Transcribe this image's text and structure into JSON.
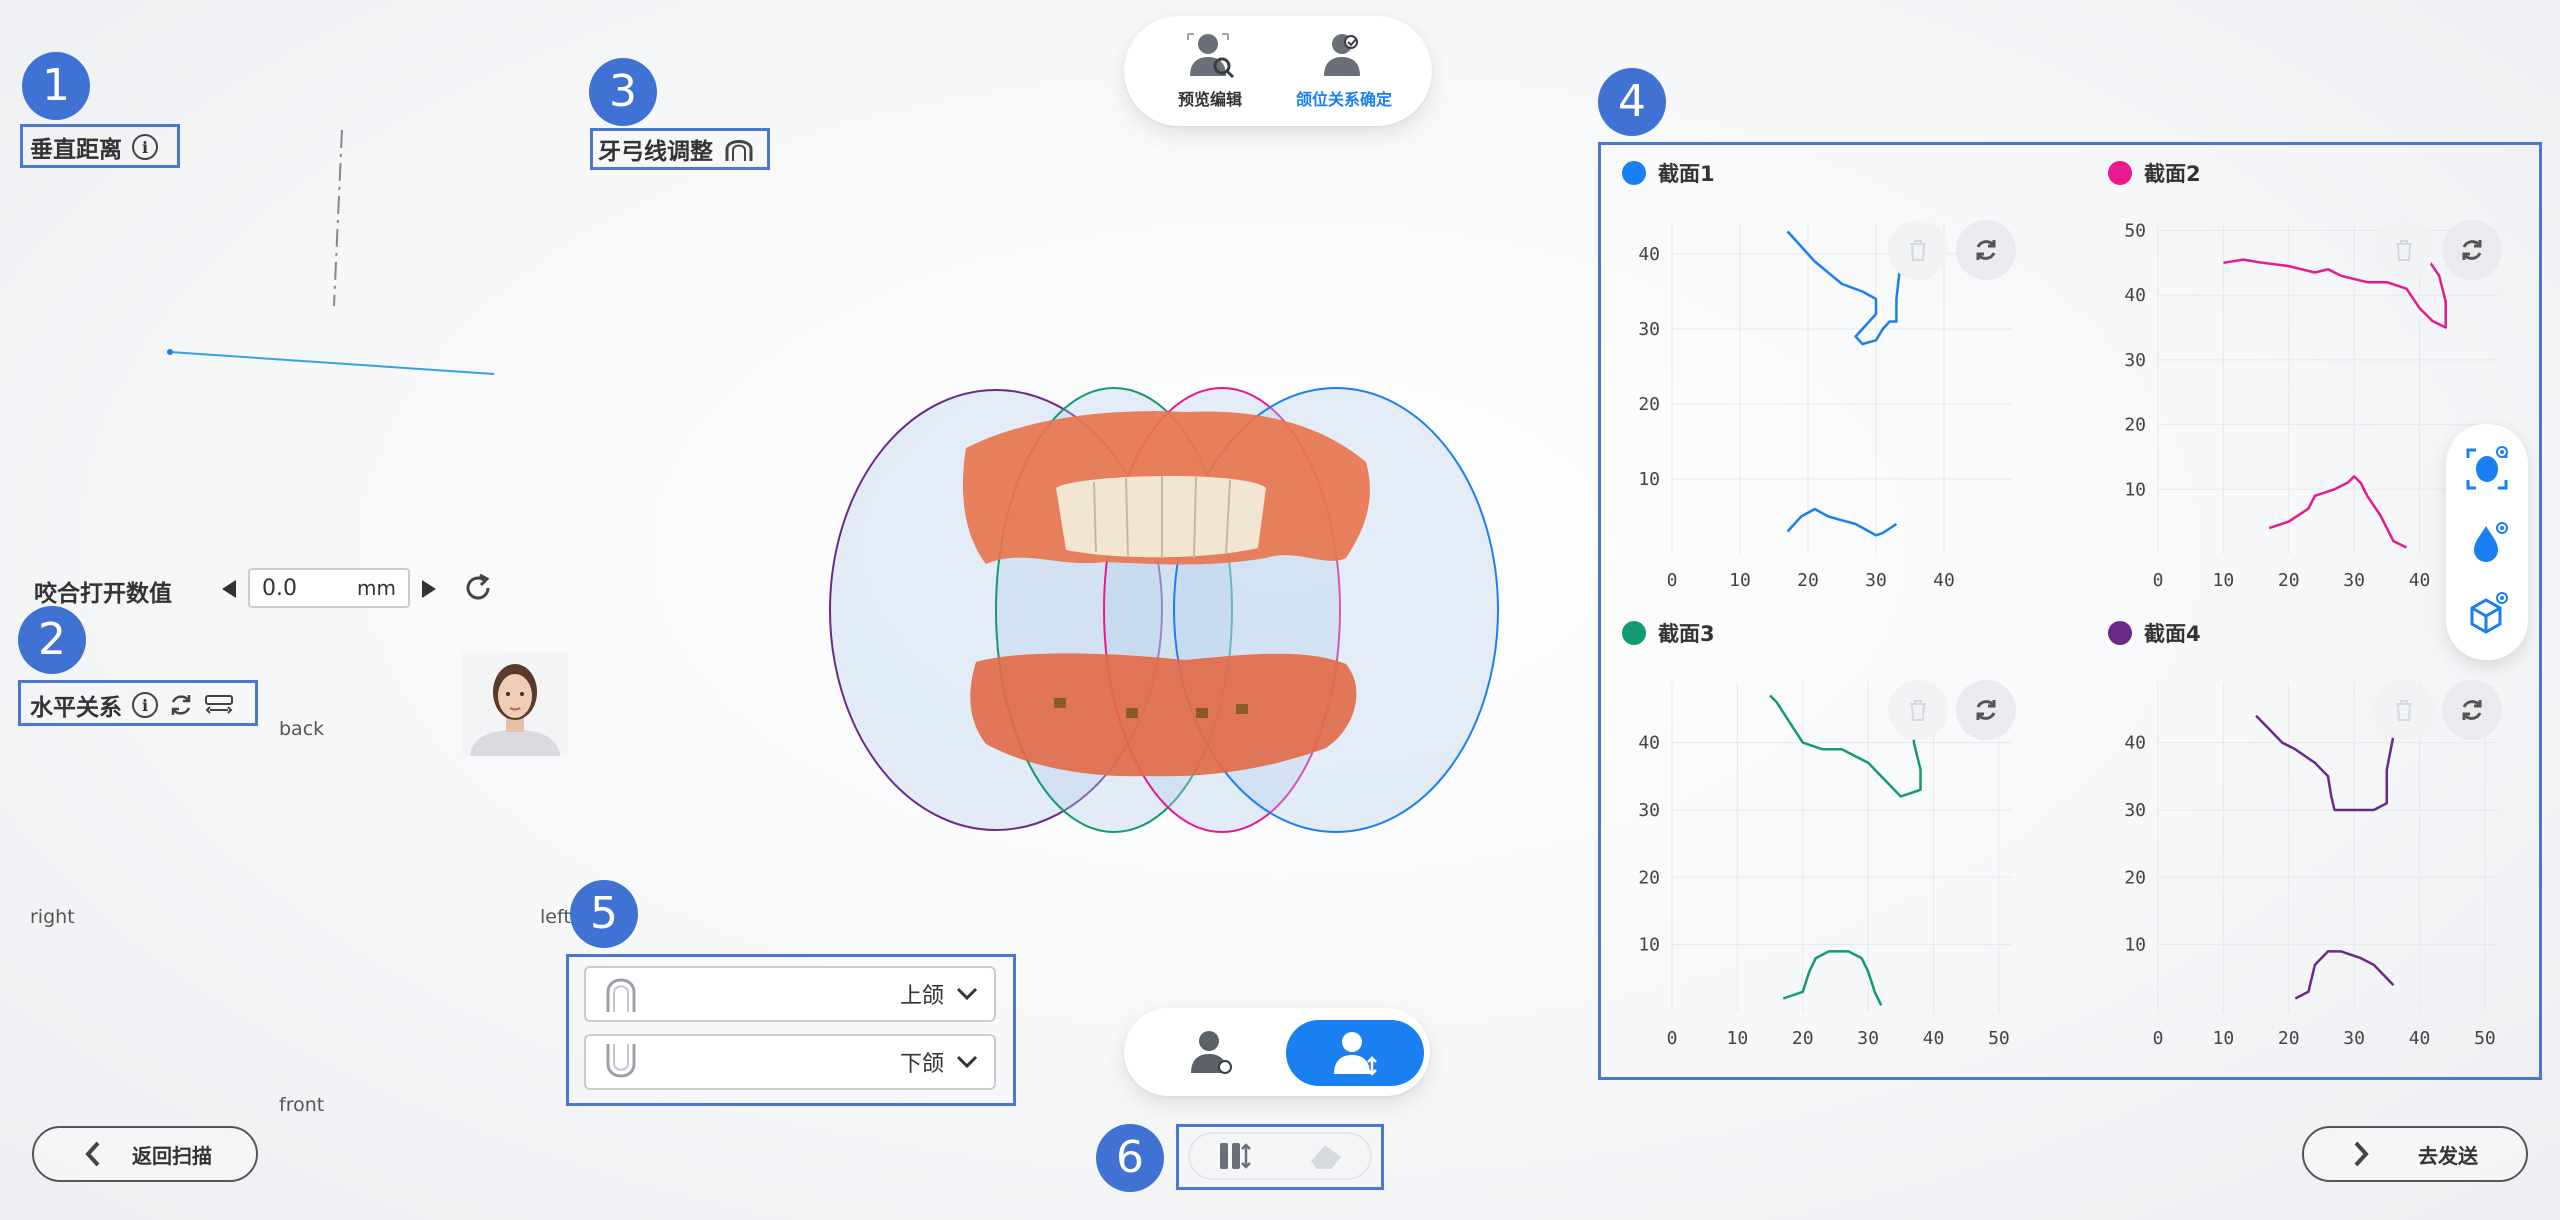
{
  "top_toolbar": {
    "preview_edit": "预览编辑",
    "jaw_relation_confirm": "颌位关系确定",
    "accent": "#1a7ff0"
  },
  "markers": [
    "1",
    "2",
    "3",
    "4",
    "5",
    "6"
  ],
  "left_panel": {
    "vertical_distance": "垂直距离",
    "arch_line_adjust": "牙弓线调整",
    "bite_open_label": "咬合打开数值",
    "bite_open_value": "0.0",
    "bite_open_unit": "mm",
    "horizontal_relation": "水平关系",
    "orientation": {
      "back": "back",
      "right": "right",
      "left": "left",
      "front": "front"
    }
  },
  "jaw_select": [
    {
      "icon": "upper-arch-icon",
      "value": "上颌"
    },
    {
      "icon": "lower-arch-icon",
      "value": "下颌"
    }
  ],
  "buttons": {
    "back_scan": "返回扫描",
    "send": "去发送"
  },
  "sections": {
    "colors": {
      "s1": "#1a7ff0",
      "s2": "#e8198e",
      "s3": "#139a72",
      "s4": "#6a2a86"
    },
    "titles": [
      "截面1",
      "截面2",
      "截面3",
      "截面4"
    ]
  },
  "chart_data": [
    {
      "type": "line",
      "title": "截面1",
      "xlim": [
        0,
        50
      ],
      "ylim": [
        0,
        44
      ],
      "xticks": [
        0,
        10,
        20,
        30,
        40
      ],
      "yticks": [
        10,
        20,
        30,
        40
      ],
      "series": [
        {
          "points": [
            [
              17,
              43
            ],
            [
              21,
              39
            ],
            [
              25,
              36
            ],
            [
              28,
              35
            ],
            [
              30,
              34
            ],
            [
              30,
              32
            ],
            [
              28,
              30
            ],
            [
              27,
              29
            ],
            [
              28,
              28
            ],
            [
              30,
              28.5
            ],
            [
              31,
              30
            ],
            [
              32,
              31
            ],
            [
              33,
              31
            ],
            [
              33,
              34
            ],
            [
              33.5,
              38
            ],
            [
              34,
              43
            ]
          ]
        },
        {
          "points": [
            [
              17,
              3
            ],
            [
              19,
              5
            ],
            [
              21,
              6
            ],
            [
              22,
              5.5
            ],
            [
              23,
              5
            ],
            [
              25,
              4.5
            ],
            [
              27,
              4
            ],
            [
              29,
              3
            ],
            [
              30,
              2.5
            ],
            [
              31,
              2.8
            ],
            [
              33,
              4
            ]
          ]
        }
      ]
    },
    {
      "type": "line",
      "title": "截面2",
      "xlim": [
        0,
        52
      ],
      "ylim": [
        0,
        51
      ],
      "xticks": [
        0,
        10,
        20,
        30,
        40
      ],
      "yticks": [
        10,
        20,
        30,
        40,
        50
      ],
      "series": [
        {
          "points": [
            [
              10,
              45
            ],
            [
              13,
              45.5
            ],
            [
              16,
              45
            ],
            [
              20,
              44.5
            ],
            [
              22,
              44
            ],
            [
              24,
              43.5
            ],
            [
              26,
              44
            ],
            [
              28,
              43
            ],
            [
              32,
              42
            ],
            [
              35,
              42
            ],
            [
              38,
              41
            ],
            [
              40,
              38
            ],
            [
              42,
              36
            ],
            [
              44,
              35
            ],
            [
              44,
              39
            ],
            [
              43,
              43
            ],
            [
              41,
              46
            ],
            [
              40,
              50
            ]
          ]
        },
        {
          "points": [
            [
              17,
              4
            ],
            [
              20,
              5
            ],
            [
              23,
              7
            ],
            [
              24,
              9
            ],
            [
              27,
              10
            ],
            [
              29,
              11
            ],
            [
              30,
              12
            ],
            [
              31,
              11
            ],
            [
              32,
              9
            ],
            [
              34,
              6
            ],
            [
              35,
              4
            ],
            [
              36,
              2
            ],
            [
              38,
              1
            ]
          ]
        }
      ]
    },
    {
      "type": "line",
      "title": "截面3",
      "xlim": [
        0,
        52
      ],
      "ylim": [
        0,
        49
      ],
      "xticks": [
        0,
        10,
        20,
        30,
        40,
        50
      ],
      "yticks": [
        10,
        20,
        30,
        40
      ],
      "series": [
        {
          "points": [
            [
              15,
              47
            ],
            [
              16,
              46
            ],
            [
              18,
              43
            ],
            [
              20,
              40
            ],
            [
              23,
              39
            ],
            [
              26,
              39
            ],
            [
              28,
              38
            ],
            [
              30,
              37
            ],
            [
              32,
              35
            ],
            [
              35,
              32
            ],
            [
              38,
              33
            ],
            [
              38,
              36
            ],
            [
              37,
              40
            ],
            [
              37,
              45
            ],
            [
              36,
              47
            ]
          ]
        },
        {
          "points": [
            [
              17,
              2
            ],
            [
              20,
              3
            ],
            [
              21,
              6
            ],
            [
              22,
              8
            ],
            [
              24,
              9
            ],
            [
              27,
              9
            ],
            [
              29,
              8
            ],
            [
              30,
              6
            ],
            [
              31,
              3
            ],
            [
              32,
              1
            ]
          ]
        }
      ]
    },
    {
      "type": "line",
      "title": "截面4",
      "xlim": [
        0,
        52
      ],
      "ylim": [
        0,
        49
      ],
      "xticks": [
        0,
        10,
        20,
        30,
        40,
        50
      ],
      "yticks": [
        10,
        20,
        30,
        40
      ],
      "series": [
        {
          "points": [
            [
              15,
              44
            ],
            [
              17,
              42
            ],
            [
              19,
              40
            ],
            [
              21,
              39
            ],
            [
              24,
              37
            ],
            [
              26,
              35
            ],
            [
              26.5,
              32
            ],
            [
              27,
              30
            ],
            [
              29,
              30
            ],
            [
              31,
              30
            ],
            [
              33,
              30
            ],
            [
              35,
              31
            ],
            [
              35,
              36
            ],
            [
              36,
              41
            ],
            [
              36,
              47
            ]
          ]
        },
        {
          "points": [
            [
              21,
              2
            ],
            [
              23,
              3
            ],
            [
              24,
              7
            ],
            [
              26,
              9
            ],
            [
              28,
              9
            ],
            [
              31,
              8
            ],
            [
              33,
              7
            ],
            [
              35,
              5
            ],
            [
              36,
              4
            ]
          ]
        }
      ]
    }
  ]
}
